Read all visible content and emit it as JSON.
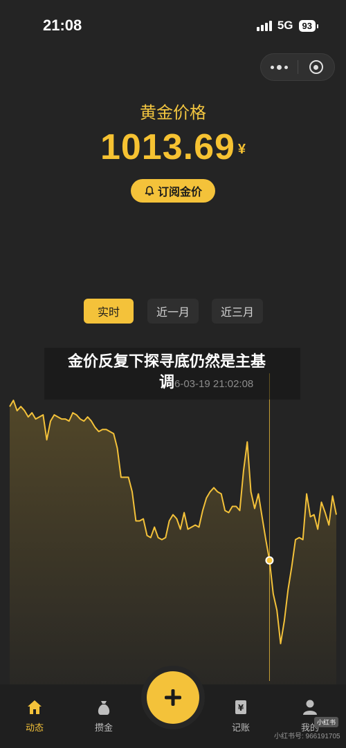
{
  "status_bar": {
    "time": "21:08",
    "network": "5G",
    "battery": "93"
  },
  "hero": {
    "title": "黄金价格",
    "price": "1013.69",
    "currency": "¥",
    "subscribe_label": "订阅金价"
  },
  "tabs": [
    {
      "label": "实时",
      "active": true
    },
    {
      "label": "近一月",
      "active": false
    },
    {
      "label": "近三月",
      "active": false
    }
  ],
  "headline": {
    "main": "金价反复下探寻底仍然是主基",
    "overflow": "调"
  },
  "tooltip": {
    "timestamp": "6-03-19 21:02:08"
  },
  "chart_data": {
    "type": "area",
    "title": "",
    "xlabel": "",
    "ylabel": "",
    "series_color": "#f4c23a",
    "values": [
      1045,
      1048,
      1043,
      1045,
      1043,
      1040,
      1042,
      1039,
      1040,
      1041,
      1029,
      1038,
      1041,
      1040,
      1039,
      1039,
      1038,
      1042,
      1041,
      1039,
      1038,
      1040,
      1038,
      1035,
      1033,
      1034,
      1034,
      1033,
      1032,
      1025,
      1011,
      1011,
      1011,
      1004,
      990,
      990,
      991,
      983,
      982,
      987,
      982,
      981,
      982,
      990,
      993,
      991,
      986,
      994,
      986,
      987,
      988,
      987,
      995,
      1001,
      1004,
      1006,
      1004,
      1003,
      995,
      994,
      997,
      997,
      995,
      1014,
      1028,
      1004,
      996,
      1003,
      992,
      981,
      971,
      955,
      947,
      931,
      942,
      957,
      968,
      981,
      982,
      981,
      1003,
      992,
      993,
      986,
      999,
      994,
      988,
      1002,
      993
    ],
    "marker_index": 70,
    "marker_value": "965.6"
  },
  "bottom_nav": {
    "items": [
      {
        "label": "动态",
        "active": true
      },
      {
        "label": "攒金",
        "active": false
      },
      {
        "label": "记账",
        "active": false
      },
      {
        "label": "我的",
        "active": false
      }
    ]
  },
  "watermark": {
    "text": "小红书号: 966191705",
    "badge": "小红书"
  }
}
